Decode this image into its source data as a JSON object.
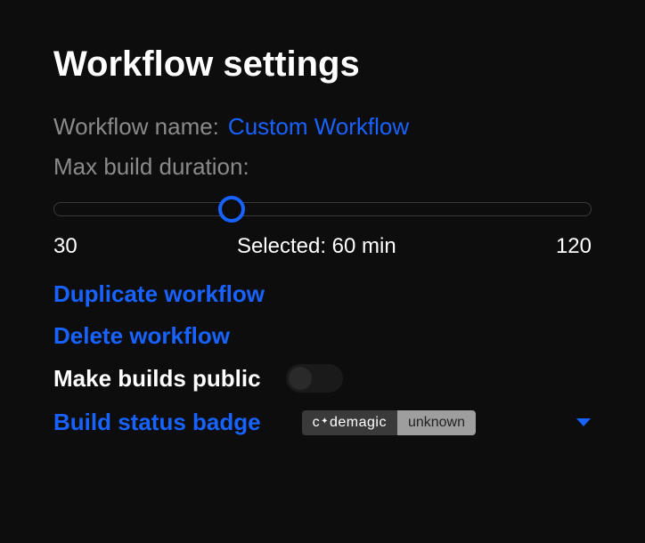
{
  "title": "Workflow settings",
  "name_label": "Workflow name:",
  "name_value": "Custom Workflow",
  "duration_label": "Max build duration:",
  "slider": {
    "min": "30",
    "max": "120",
    "selected": "Selected: 60 min"
  },
  "actions": {
    "duplicate": "Duplicate workflow",
    "delete": "Delete workflow"
  },
  "public_label": "Make builds public",
  "badge_section": {
    "label": "Build status badge",
    "brand_pre": "c",
    "brand_post": "demagic",
    "status": "unknown"
  }
}
